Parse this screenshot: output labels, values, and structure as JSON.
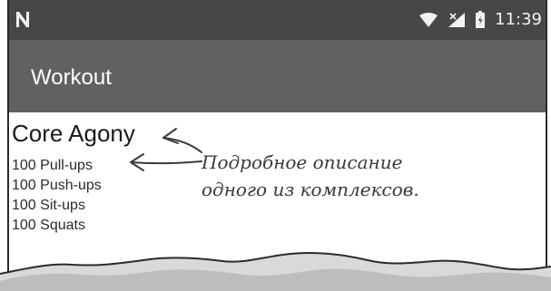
{
  "status_bar": {
    "time": "11:39",
    "left_icon": "n-notification-icon",
    "wifi_icon": "wifi-icon",
    "signal_icon": "cell-signal-icon",
    "battery_icon": "battery-icon"
  },
  "app_bar": {
    "title": "Workout"
  },
  "detail": {
    "workout_name": "Core Agony",
    "exercises": [
      "100 Pull-ups",
      "100 Push-ups",
      "100 Sit-ups",
      "100 Squats"
    ]
  },
  "annotation": {
    "line1": "Подробное описание",
    "line2": "одного из комплексов."
  },
  "colors": {
    "status_bar": "#474747",
    "app_bar": "#616161",
    "text": "#1a1a1a",
    "annotation": "#3a3a3a"
  }
}
